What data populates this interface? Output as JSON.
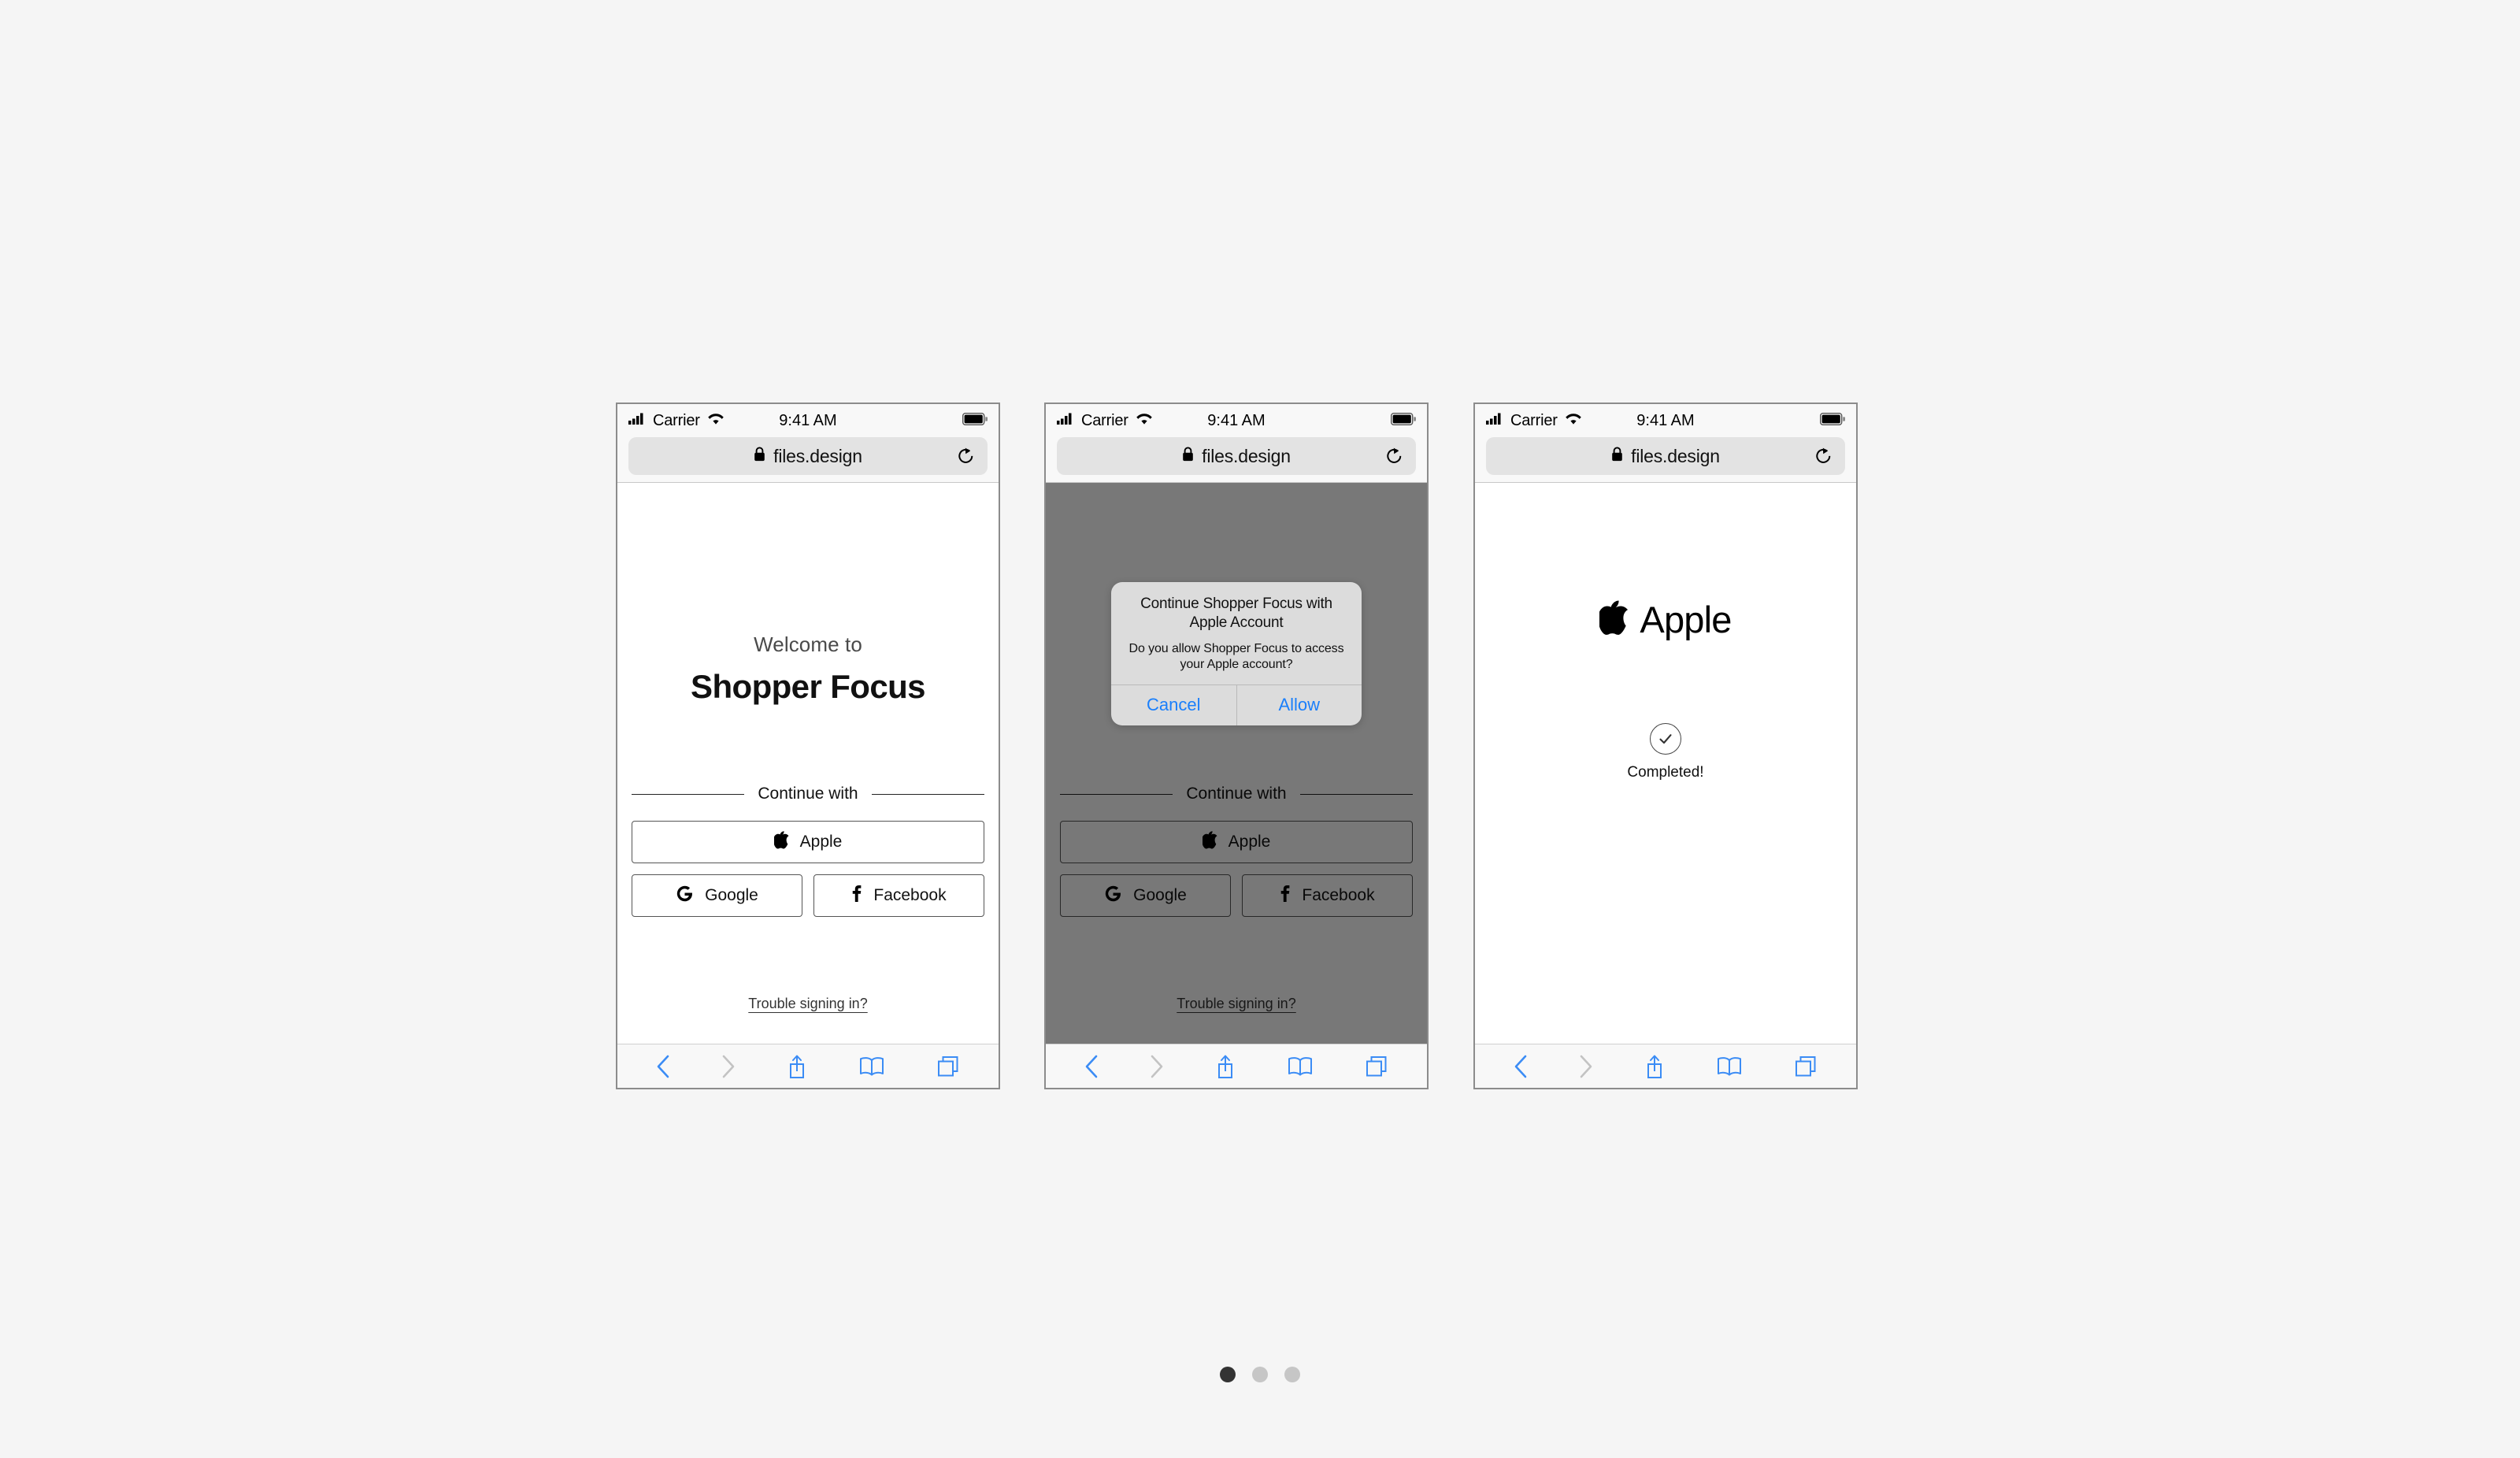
{
  "canvas": {
    "background": "#f5f5f5"
  },
  "pagination": {
    "dots": 3,
    "active_index": 0,
    "active_color": "#333333",
    "inactive_color": "#c6c6c6"
  },
  "status_bar": {
    "carrier": "Carrier",
    "time": "9:41 AM",
    "signal_icon": "cellular-signal-icon",
    "wifi_icon": "wifi-icon",
    "battery_icon": "battery-full-icon"
  },
  "browser": {
    "url": "files.design",
    "lock_icon": "lock-icon",
    "reload_icon": "reload-icon",
    "toolbar": [
      {
        "name": "back",
        "icon": "chevron-left-icon",
        "enabled": true
      },
      {
        "name": "forward",
        "icon": "chevron-right-icon",
        "enabled": false
      },
      {
        "name": "share",
        "icon": "share-icon",
        "enabled": true
      },
      {
        "name": "bookmarks",
        "icon": "book-icon",
        "enabled": true
      },
      {
        "name": "tabs",
        "icon": "tabs-icon",
        "enabled": true
      }
    ],
    "accent_color": "#3b8cf5",
    "disabled_color": "#c3c3c3"
  },
  "signin": {
    "welcome_kicker": "Welcome to",
    "app_name": "Shopper Focus",
    "divider_label": "Continue with",
    "providers": [
      {
        "id": "apple",
        "label": "Apple",
        "icon": "apple-logo-icon"
      },
      {
        "id": "google",
        "label": "Google",
        "icon": "google-logo-icon"
      },
      {
        "id": "facebook",
        "label": "Facebook",
        "icon": "facebook-logo-icon"
      }
    ],
    "trouble_link": "Trouble signing in?"
  },
  "alert": {
    "title": "Continue Shopper Focus with Apple Account",
    "message": "Do you allow Shopper Focus to access your Apple account?",
    "cancel_label": "Cancel",
    "allow_label": "Allow",
    "button_color": "#1a7ffb",
    "surface_color": "#dcdcdc",
    "scrim_color": "rgba(0,0,0,0.53)"
  },
  "success": {
    "brand_text": "Apple",
    "brand_icon": "apple-logo-icon",
    "status_icon": "check-circle-icon",
    "status_text": "Completed!"
  },
  "screens": [
    {
      "id": "screen-1",
      "name": "sign-in"
    },
    {
      "id": "screen-2",
      "name": "apple-permission-alert"
    },
    {
      "id": "screen-3",
      "name": "apple-sign-in-completed"
    }
  ]
}
